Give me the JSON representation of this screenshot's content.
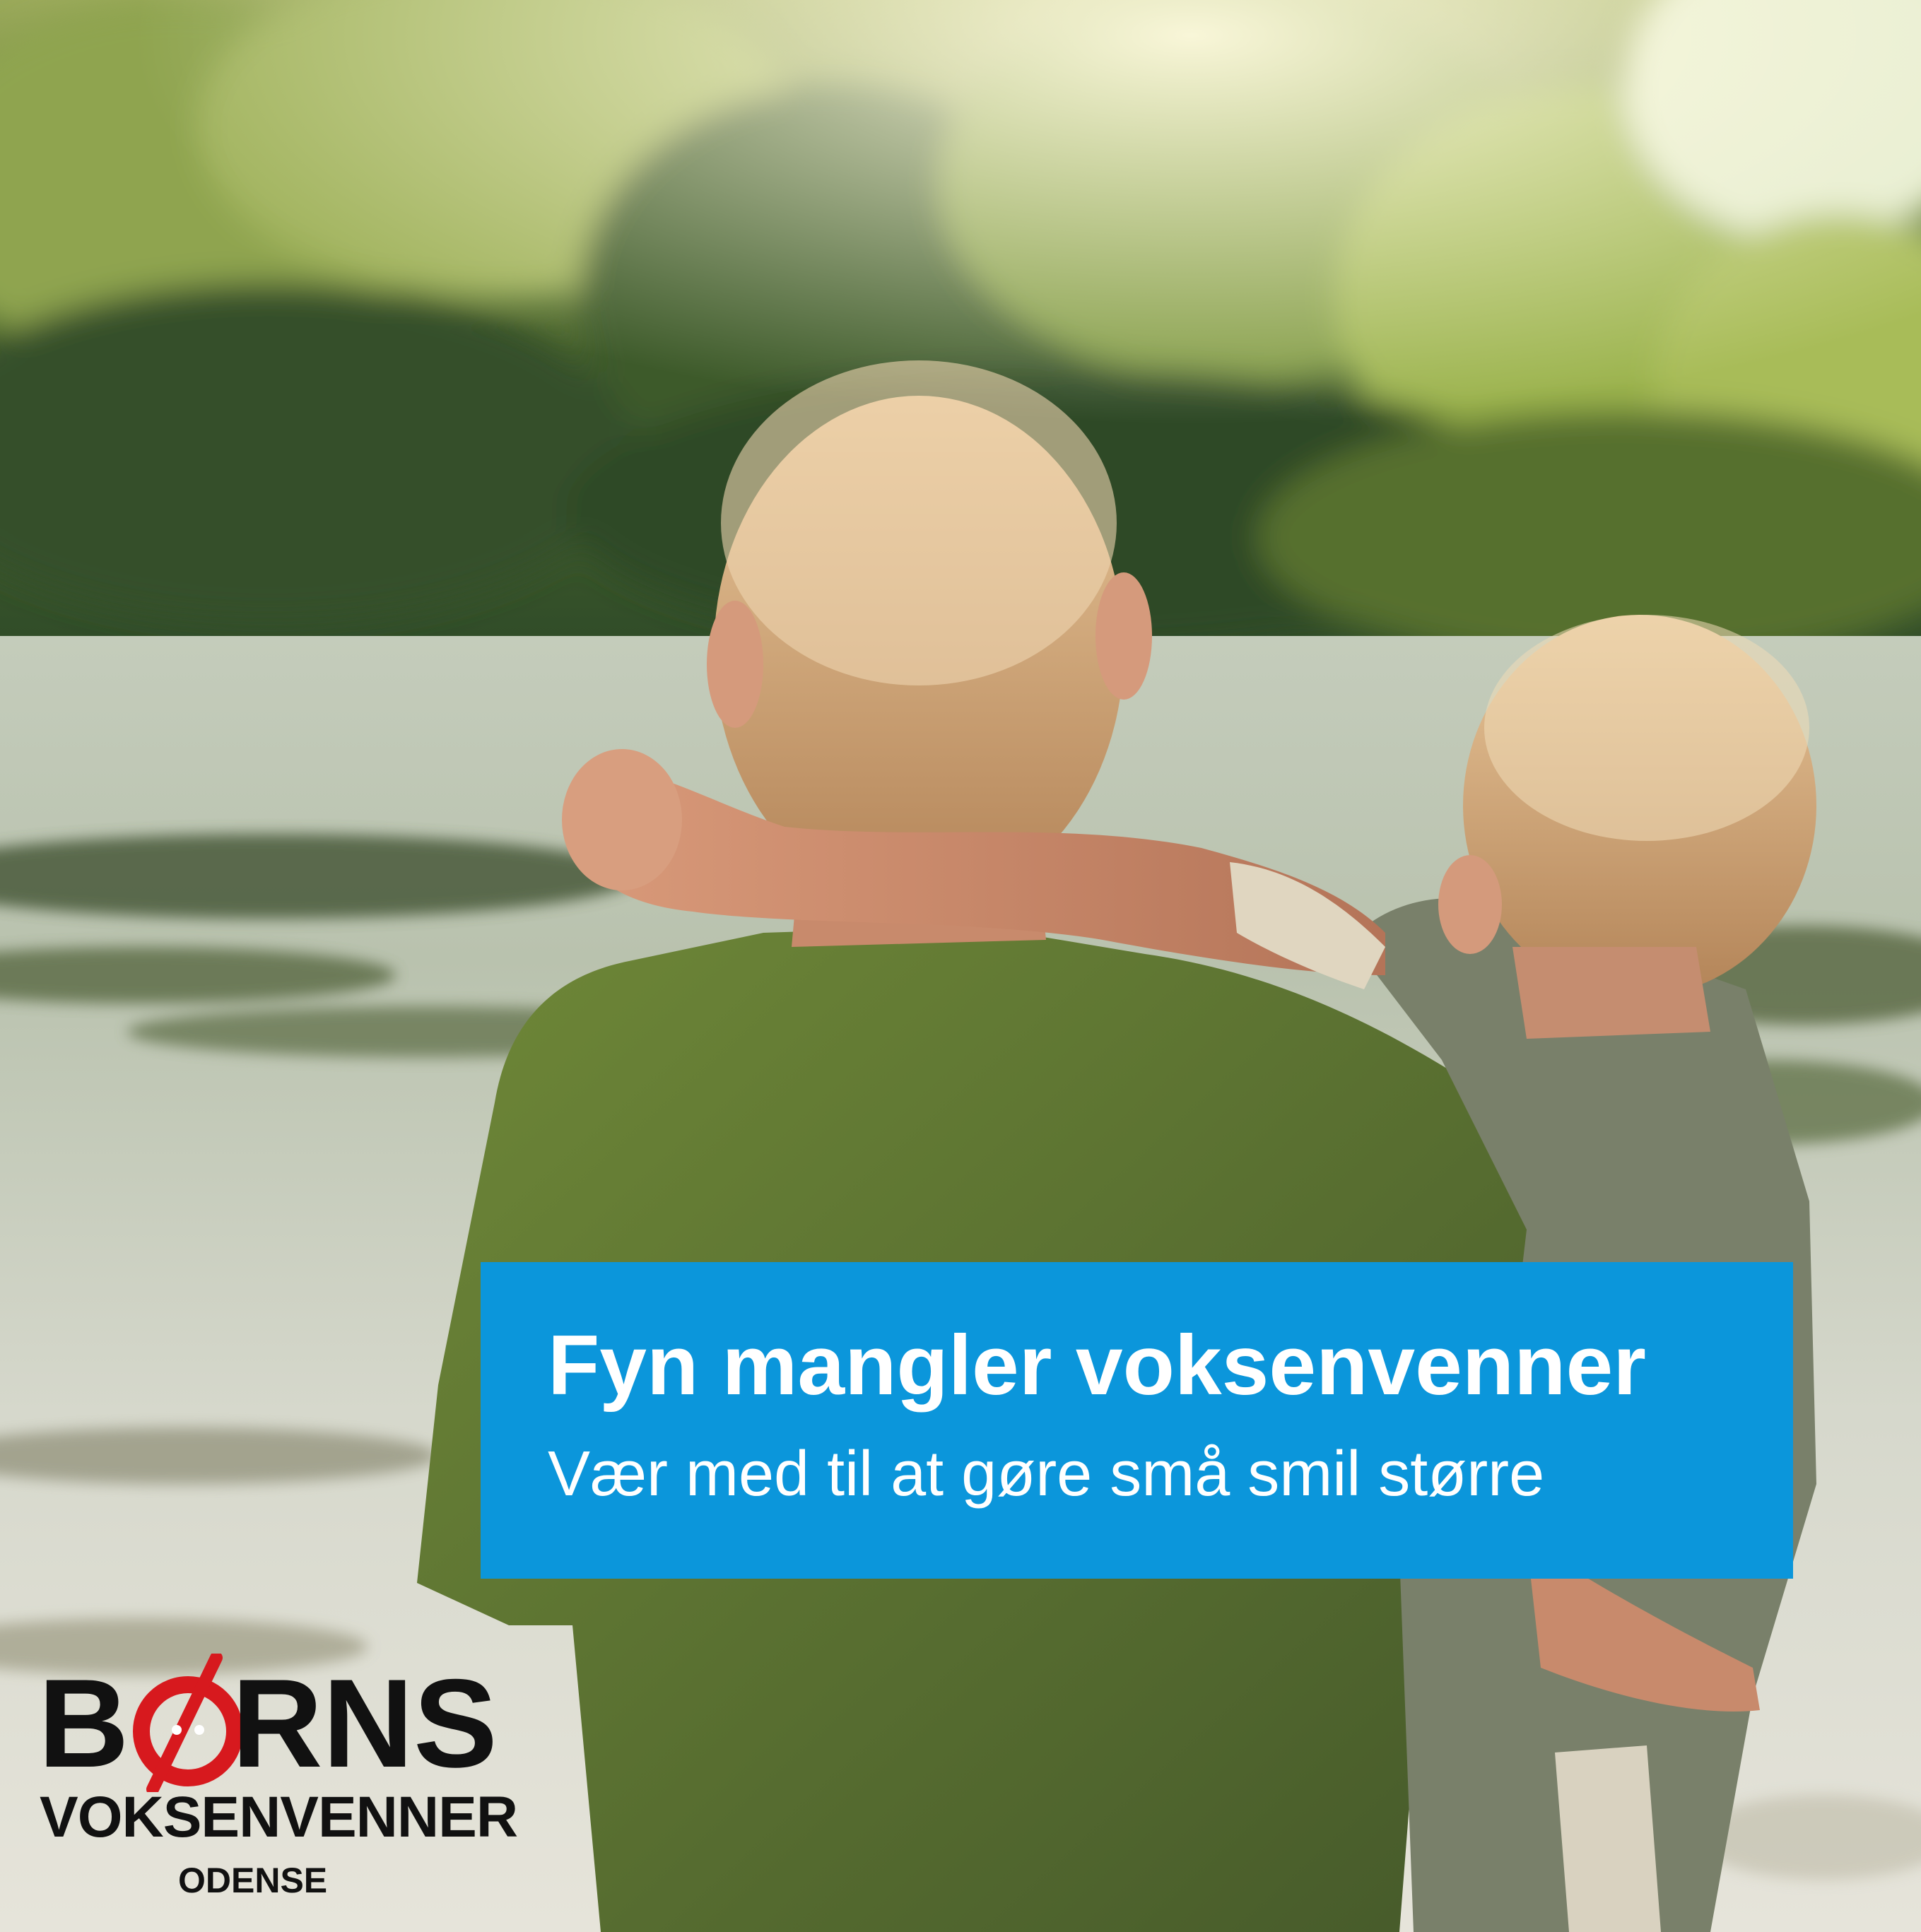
{
  "banner": {
    "headline": "Fyn mangler voksenvenner",
    "subline": "Vær med til at gøre små smil større",
    "color": "#0b96db"
  },
  "logo": {
    "letter_b": "B",
    "letter_o": "Ø",
    "letters_rns": "RNS",
    "full_name": "BØRNS",
    "subtitle": "VOKSENVENNER",
    "city": "ODENSE",
    "accent": "#d7191e"
  }
}
